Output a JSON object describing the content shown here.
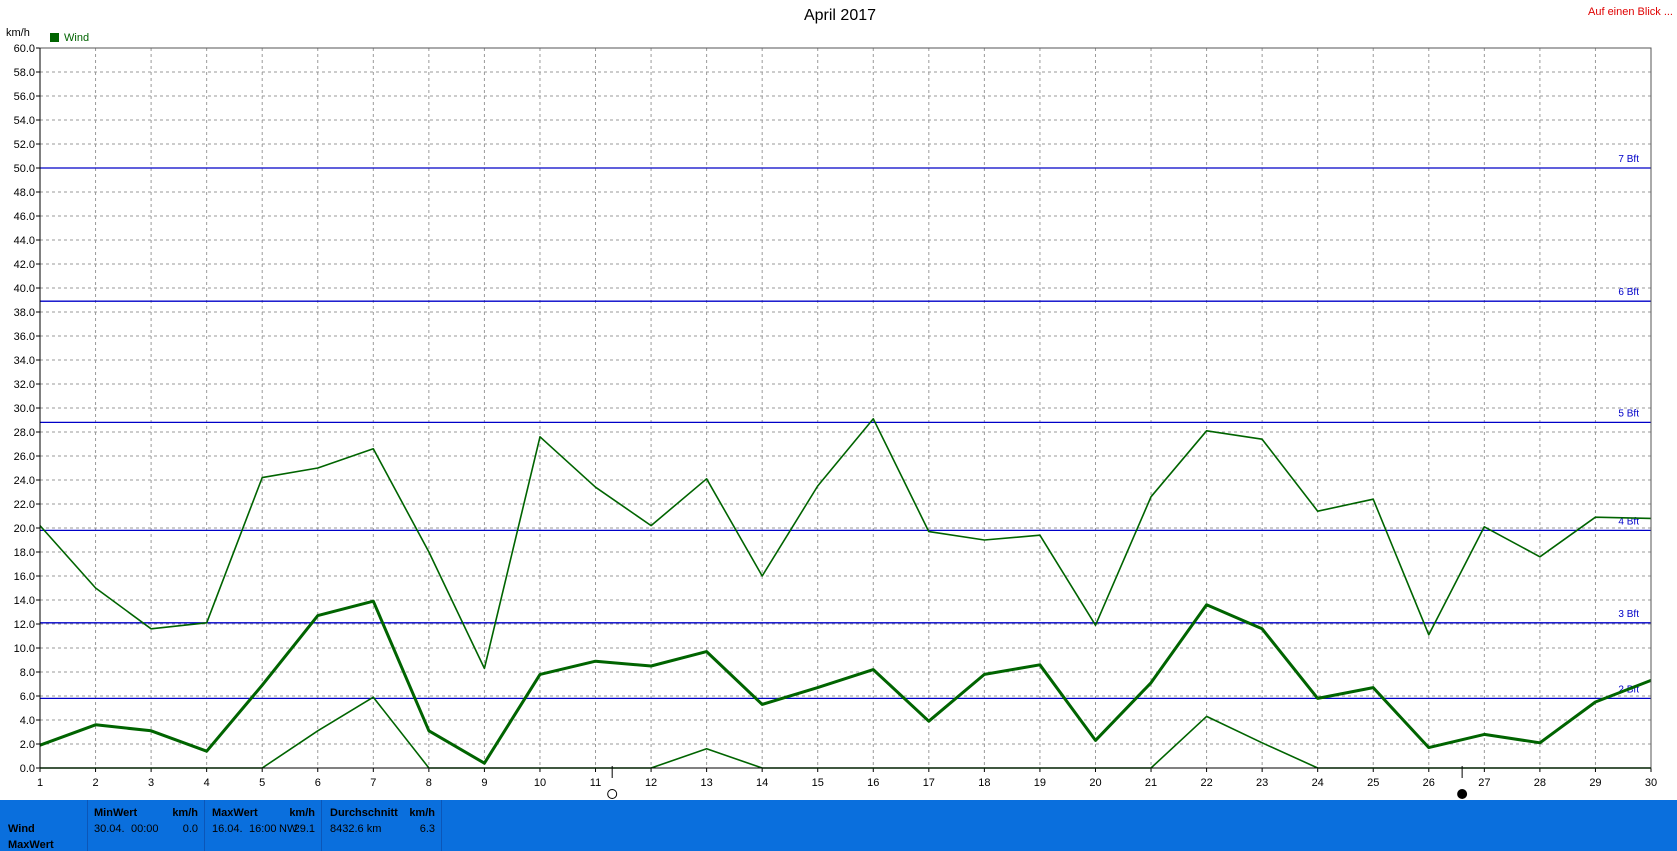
{
  "header": {
    "title": "April 2017",
    "link_label": "Auf einen Blick ...",
    "unit_label": "km/h",
    "legend_label": "Wind"
  },
  "colors": {
    "series": "#006400",
    "beaufort_lines": "#0000c8",
    "link": "#e00000",
    "stats_bar": "#0a6fdd"
  },
  "chart_data": {
    "type": "line",
    "title": "April 2017",
    "ylabel": "km/h",
    "xlabel": "",
    "ylim": [
      0,
      60
    ],
    "y_ticks": [
      "0.0",
      "2.0",
      "4.0",
      "6.0",
      "8.0",
      "10.0",
      "12.0",
      "14.0",
      "16.0",
      "18.0",
      "20.0",
      "22.0",
      "24.0",
      "26.0",
      "28.0",
      "30.0",
      "32.0",
      "34.0",
      "36.0",
      "38.0",
      "40.0",
      "42.0",
      "44.0",
      "46.0",
      "48.0",
      "50.0",
      "52.0",
      "54.0",
      "56.0",
      "58.0",
      "60.0"
    ],
    "x": [
      "1",
      "2",
      "3",
      "4",
      "5",
      "6",
      "7",
      "8",
      "9",
      "10",
      "11",
      "12",
      "13",
      "14",
      "15",
      "16",
      "17",
      "18",
      "19",
      "20",
      "21",
      "22",
      "23",
      "24",
      "25",
      "26",
      "27",
      "28",
      "29",
      "30"
    ],
    "grid": true,
    "legend_position": "top-left",
    "series": [
      {
        "name": "Wind",
        "role": "max",
        "values": [
          20.2,
          15.0,
          11.6,
          12.1,
          24.2,
          25.0,
          26.6,
          18.0,
          8.3,
          27.6,
          23.4,
          20.2,
          24.1,
          16.0,
          23.5,
          29.1,
          19.7,
          19.0,
          19.4,
          11.9,
          22.6,
          28.1,
          27.4,
          21.4,
          22.4,
          11.1,
          20.1,
          17.6,
          20.9,
          20.8
        ]
      },
      {
        "role": "average",
        "bold": true,
        "values": [
          1.9,
          3.6,
          3.1,
          1.4,
          6.9,
          12.7,
          13.9,
          3.1,
          0.4,
          7.8,
          8.9,
          8.5,
          9.7,
          5.3,
          6.7,
          8.2,
          3.9,
          7.8,
          8.6,
          2.3,
          7.1,
          13.6,
          11.6,
          5.8,
          6.7,
          1.7,
          2.8,
          2.1,
          5.5,
          7.3
        ]
      },
      {
        "role": "min",
        "values": [
          0,
          0,
          0,
          0,
          0,
          3.1,
          5.9,
          0,
          0,
          0,
          0,
          0,
          1.6,
          0,
          0,
          0,
          0,
          0,
          0,
          0,
          0,
          4.3,
          2.1,
          0,
          0,
          0,
          0,
          0,
          0,
          0
        ]
      }
    ],
    "beaufort_lines": [
      {
        "label": "2 Bft",
        "value": 5.8
      },
      {
        "label": "3 Bft",
        "value": 12.1
      },
      {
        "label": "4 Bft",
        "value": 19.8
      },
      {
        "label": "5 Bft",
        "value": 28.8
      },
      {
        "label": "6 Bft",
        "value": 38.9
      },
      {
        "label": "7 Bft",
        "value": 50.0
      }
    ],
    "moon_markers": [
      {
        "phase": "full-moon",
        "day": 11.3
      },
      {
        "phase": "new-moon",
        "day": 26.6
      }
    ]
  },
  "stats": {
    "rows": [
      "Wind",
      "MaxWert"
    ],
    "columns": [
      {
        "header": "MinWert",
        "unit": "km/h",
        "date": "30.04.",
        "time": "00:00",
        "extra": "",
        "value": "0.0"
      },
      {
        "header": "MaxWert",
        "unit": "km/h",
        "date": "16.04.",
        "time": "16:00",
        "extra": "NW",
        "value": "29.1"
      },
      {
        "header": "Durchschnitt",
        "unit": "km/h",
        "date": "8432.6 km",
        "time": "",
        "extra": "",
        "value": "6.3"
      }
    ]
  }
}
